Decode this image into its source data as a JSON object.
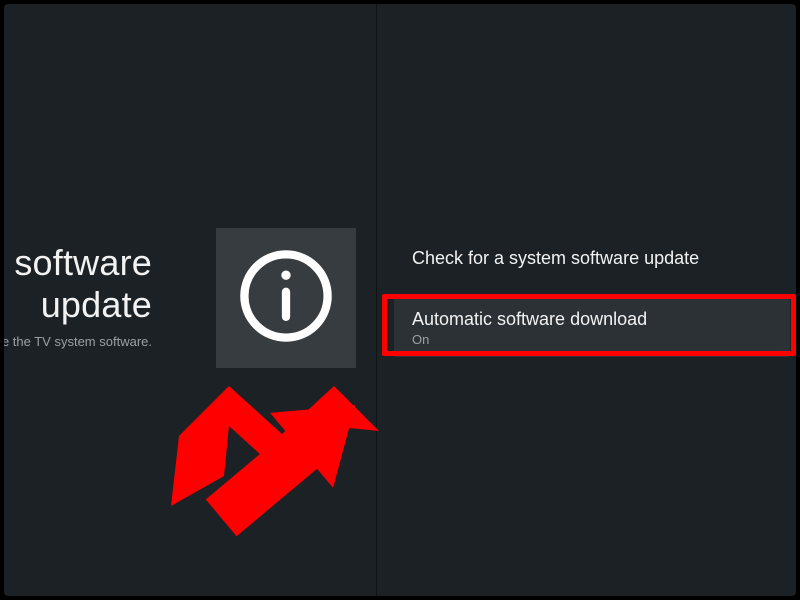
{
  "left": {
    "title_line1": "n software",
    "title_line2": "update",
    "subtitle": "te the TV system software."
  },
  "icons": {
    "info": "info-icon"
  },
  "right": {
    "items": [
      {
        "label": "Check for a system software update",
        "value": null
      },
      {
        "label": "Automatic software download",
        "value": "On"
      }
    ]
  },
  "annotation": {
    "highlight_color": "#ff0000"
  }
}
